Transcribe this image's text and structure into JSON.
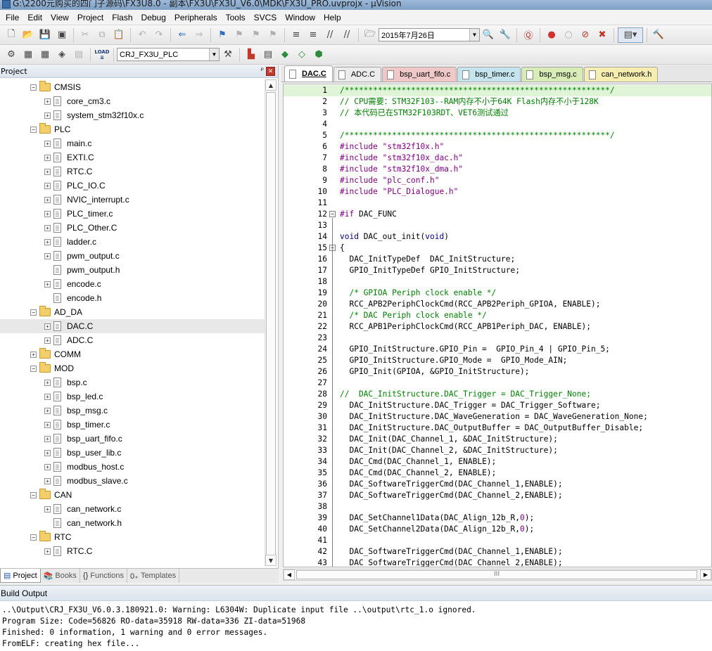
{
  "window": {
    "title": "G:\\2200元购买的四门子源码\\FX3U8.0 - 副本\\FX3U\\FX3U_V6.0\\MDK\\FX3U_PRO.uvprojx - µVision"
  },
  "menu": [
    "File",
    "Edit",
    "View",
    "Project",
    "Flash",
    "Debug",
    "Peripherals",
    "Tools",
    "SVCS",
    "Window",
    "Help"
  ],
  "toolbar": {
    "date_value": "2015年7月26日",
    "target_value": "CRJ_FX3U_PLC",
    "load_label": "LOAD"
  },
  "project_panel": {
    "title": "Project",
    "tree": [
      {
        "label": "CMSIS",
        "kind": "folder",
        "level": 1
      },
      {
        "label": "core_cm3.c",
        "kind": "file",
        "level": 2,
        "expander": true
      },
      {
        "label": "system_stm32f10x.c",
        "kind": "file",
        "level": 2,
        "expander": true
      },
      {
        "label": "PLC",
        "kind": "folder",
        "level": 1
      },
      {
        "label": "main.c",
        "kind": "file",
        "level": 2,
        "expander": true
      },
      {
        "label": "EXTI.C",
        "kind": "file",
        "level": 2,
        "expander": true
      },
      {
        "label": "RTC.C",
        "kind": "file",
        "level": 2,
        "expander": true
      },
      {
        "label": "PLC_IO.C",
        "kind": "file",
        "level": 2,
        "expander": true
      },
      {
        "label": "NVIC_interrupt.c",
        "kind": "file",
        "level": 2,
        "expander": true
      },
      {
        "label": "PLC_timer.c",
        "kind": "file",
        "level": 2,
        "expander": true
      },
      {
        "label": "PLC_Other.C",
        "kind": "file",
        "level": 2,
        "expander": true
      },
      {
        "label": "ladder.c",
        "kind": "file",
        "level": 2,
        "expander": true
      },
      {
        "label": "pwm_output.c",
        "kind": "file",
        "level": 2,
        "expander": true
      },
      {
        "label": "pwm_output.h",
        "kind": "file",
        "level": 2,
        "expander": false
      },
      {
        "label": "encode.c",
        "kind": "file",
        "level": 2,
        "expander": true
      },
      {
        "label": "encode.h",
        "kind": "file",
        "level": 2,
        "expander": false
      },
      {
        "label": "AD_DA",
        "kind": "folder",
        "level": 1
      },
      {
        "label": "DAC.C",
        "kind": "file",
        "level": 2,
        "expander": true,
        "selected": true
      },
      {
        "label": "ADC.C",
        "kind": "file",
        "level": 2,
        "expander": true
      },
      {
        "label": "COMM",
        "kind": "folder",
        "level": 1,
        "collapsed": true
      },
      {
        "label": "MOD",
        "kind": "folder",
        "level": 1
      },
      {
        "label": "bsp.c",
        "kind": "file",
        "level": 2,
        "expander": true
      },
      {
        "label": "bsp_led.c",
        "kind": "file",
        "level": 2,
        "expander": true
      },
      {
        "label": "bsp_msg.c",
        "kind": "file",
        "level": 2,
        "expander": true
      },
      {
        "label": "bsp_timer.c",
        "kind": "file",
        "level": 2,
        "expander": true
      },
      {
        "label": "bsp_uart_fifo.c",
        "kind": "file",
        "level": 2,
        "expander": true
      },
      {
        "label": "bsp_user_lib.c",
        "kind": "file",
        "level": 2,
        "expander": true
      },
      {
        "label": "modbus_host.c",
        "kind": "file",
        "level": 2,
        "expander": true
      },
      {
        "label": "modbus_slave.c",
        "kind": "file",
        "level": 2,
        "expander": true
      },
      {
        "label": "CAN",
        "kind": "folder",
        "level": 1
      },
      {
        "label": "can_network.c",
        "kind": "file",
        "level": 2,
        "expander": true
      },
      {
        "label": "can_network.h",
        "kind": "file",
        "level": 2,
        "expander": false
      },
      {
        "label": "RTC",
        "kind": "folder",
        "level": 1
      },
      {
        "label": "RTC.C",
        "kind": "file",
        "level": 2,
        "expander": true
      }
    ],
    "tabs": [
      "Project",
      "Books",
      "Functions",
      "Templates"
    ]
  },
  "editor": {
    "tabs": [
      {
        "label": "DAC.C",
        "color": "#ffffff",
        "active": true
      },
      {
        "label": "ADC.C",
        "color": "#ececec",
        "active": false
      },
      {
        "label": "bsp_uart_fifo.c",
        "color": "#f0c8c8",
        "active": false
      },
      {
        "label": "bsp_timer.c",
        "color": "#c4e4ee",
        "active": false
      },
      {
        "label": "bsp_msg.c",
        "color": "#d8ecb8",
        "active": false
      },
      {
        "label": "can_network.h",
        "color": "#f6eeb0",
        "active": false
      }
    ],
    "lines": [
      {
        "n": "1",
        "t": [
          [
            "c-comment",
            "/********************************************************/"
          ]
        ],
        "hl": true
      },
      {
        "n": "2",
        "t": [
          [
            "c-comment",
            "// CPU需要：STM32F103--RAM内存不小于64K Flash内存不小于128K"
          ]
        ]
      },
      {
        "n": "3",
        "t": [
          [
            "c-comment",
            "// 本代码已在STM32F103RDT、VET6测试通过"
          ]
        ]
      },
      {
        "n": "4",
        "t": []
      },
      {
        "n": "5",
        "t": [
          [
            "c-comment",
            "/********************************************************/"
          ]
        ]
      },
      {
        "n": "6",
        "t": [
          [
            "c-pre",
            "#include "
          ],
          [
            "c-str",
            "\"stm32f10x.h\""
          ]
        ]
      },
      {
        "n": "7",
        "t": [
          [
            "c-pre",
            "#include "
          ],
          [
            "c-str",
            "\"stm32f10x_dac.h\""
          ]
        ]
      },
      {
        "n": "8",
        "t": [
          [
            "c-pre",
            "#include "
          ],
          [
            "c-str",
            "\"stm32f10x_dma.h\""
          ]
        ]
      },
      {
        "n": "9",
        "t": [
          [
            "c-pre",
            "#include "
          ],
          [
            "c-str",
            "\"plc_conf.h\""
          ]
        ]
      },
      {
        "n": "10",
        "t": [
          [
            "c-pre",
            "#include "
          ],
          [
            "c-str",
            "\"PLC_Dialogue.h\""
          ]
        ]
      },
      {
        "n": "11",
        "t": []
      },
      {
        "n": "12",
        "t": [
          [
            "c-pre",
            "#if "
          ],
          [
            "c-plain",
            "DAC_FUNC"
          ]
        ],
        "fold": "-"
      },
      {
        "n": "13",
        "t": []
      },
      {
        "n": "14",
        "t": [
          [
            "c-kw",
            "void "
          ],
          [
            "c-plain",
            "DAC_out_init("
          ],
          [
            "c-kw",
            "void"
          ],
          [
            "c-plain",
            ")"
          ]
        ]
      },
      {
        "n": "15",
        "t": [
          [
            "c-plain",
            "{"
          ]
        ],
        "fold": "-"
      },
      {
        "n": "16",
        "t": [
          [
            "c-plain",
            "  DAC_InitTypeDef  DAC_InitStructure;"
          ]
        ]
      },
      {
        "n": "17",
        "t": [
          [
            "c-plain",
            "  GPIO_InitTypeDef GPIO_InitStructure;"
          ]
        ]
      },
      {
        "n": "18",
        "t": []
      },
      {
        "n": "19",
        "t": [
          [
            "c-comment",
            "  /* GPIOA Periph clock enable */"
          ]
        ]
      },
      {
        "n": "20",
        "t": [
          [
            "c-plain",
            "  RCC_APB2PeriphClockCmd(RCC_APB2Periph_GPIOA, ENABLE);"
          ]
        ]
      },
      {
        "n": "21",
        "t": [
          [
            "c-comment",
            "  /* DAC Periph clock enable */"
          ]
        ]
      },
      {
        "n": "22",
        "t": [
          [
            "c-plain",
            "  RCC_APB1PeriphClockCmd(RCC_APB1Periph_DAC, ENABLE);"
          ]
        ]
      },
      {
        "n": "23",
        "t": []
      },
      {
        "n": "24",
        "t": [
          [
            "c-plain",
            "  GPIO_InitStructure.GPIO_Pin =  GPIO_Pin_4 | GPIO_Pin_5;"
          ]
        ]
      },
      {
        "n": "25",
        "t": [
          [
            "c-plain",
            "  GPIO_InitStructure.GPIO_Mode =  GPIO_Mode_AIN;"
          ]
        ]
      },
      {
        "n": "26",
        "t": [
          [
            "c-plain",
            "  GPIO_Init(GPIOA, &GPIO_InitStructure);"
          ]
        ]
      },
      {
        "n": "27",
        "t": []
      },
      {
        "n": "28",
        "t": [
          [
            "c-comment",
            "//  DAC_InitStructure.DAC_Trigger = DAC_Trigger_None;"
          ]
        ]
      },
      {
        "n": "29",
        "t": [
          [
            "c-plain",
            "  DAC_InitStructure.DAC_Trigger = DAC_Trigger_Software;"
          ]
        ]
      },
      {
        "n": "30",
        "t": [
          [
            "c-plain",
            "  DAC_InitStructure.DAC_WaveGeneration = DAC_WaveGeneration_None;"
          ]
        ]
      },
      {
        "n": "31",
        "t": [
          [
            "c-plain",
            "  DAC_InitStructure.DAC_OutputBuffer = DAC_OutputBuffer_Disable;"
          ]
        ]
      },
      {
        "n": "32",
        "t": [
          [
            "c-plain",
            "  DAC_Init(DAC_Channel_1, &DAC_InitStructure);"
          ]
        ]
      },
      {
        "n": "33",
        "t": [
          [
            "c-plain",
            "  DAC_Init(DAC_Channel_2, &DAC_InitStructure);"
          ]
        ]
      },
      {
        "n": "34",
        "t": [
          [
            "c-plain",
            "  DAC_Cmd(DAC_Channel_1, ENABLE);"
          ]
        ]
      },
      {
        "n": "35",
        "t": [
          [
            "c-plain",
            "  DAC_Cmd(DAC_Channel_2, ENABLE);"
          ]
        ]
      },
      {
        "n": "36",
        "t": [
          [
            "c-plain",
            "  DAC_SoftwareTriggerCmd(DAC_Channel_1,ENABLE);"
          ]
        ]
      },
      {
        "n": "37",
        "t": [
          [
            "c-plain",
            "  DAC_SoftwareTriggerCmd(DAC_Channel_2,ENABLE);"
          ]
        ]
      },
      {
        "n": "38",
        "t": []
      },
      {
        "n": "39",
        "t": [
          [
            "c-plain",
            "  DAC_SetChannel1Data(DAC_Align_12b_R,"
          ],
          [
            "c-str",
            "0"
          ],
          [
            "c-plain",
            ");"
          ]
        ]
      },
      {
        "n": "40",
        "t": [
          [
            "c-plain",
            "  DAC_SetChannel2Data(DAC_Align_12b_R,"
          ],
          [
            "c-str",
            "0"
          ],
          [
            "c-plain",
            ");"
          ]
        ]
      },
      {
        "n": "41",
        "t": []
      },
      {
        "n": "42",
        "t": [
          [
            "c-plain",
            "  DAC_SoftwareTriggerCmd(DAC_Channel_1,ENABLE);"
          ]
        ]
      },
      {
        "n": "43",
        "t": [
          [
            "c-plain",
            "  DAC_SoftwareTriggerCmd(DAC_Channel_2,ENABLE);"
          ]
        ]
      }
    ]
  },
  "build_output": {
    "title": "Build Output",
    "lines": [
      "..\\Output\\CRJ_FX3U_V6.0.3.180921.0: Warning: L6304W: Duplicate input file ..\\output\\rtc_1.o ignored.",
      "Program Size: Code=56826 RO-data=35918 RW-data=336 ZI-data=51968",
      "Finished: 0 information, 1 warning and 0 error messages.",
      "FromELF: creating hex file..."
    ]
  },
  "scroll_grip": "III"
}
